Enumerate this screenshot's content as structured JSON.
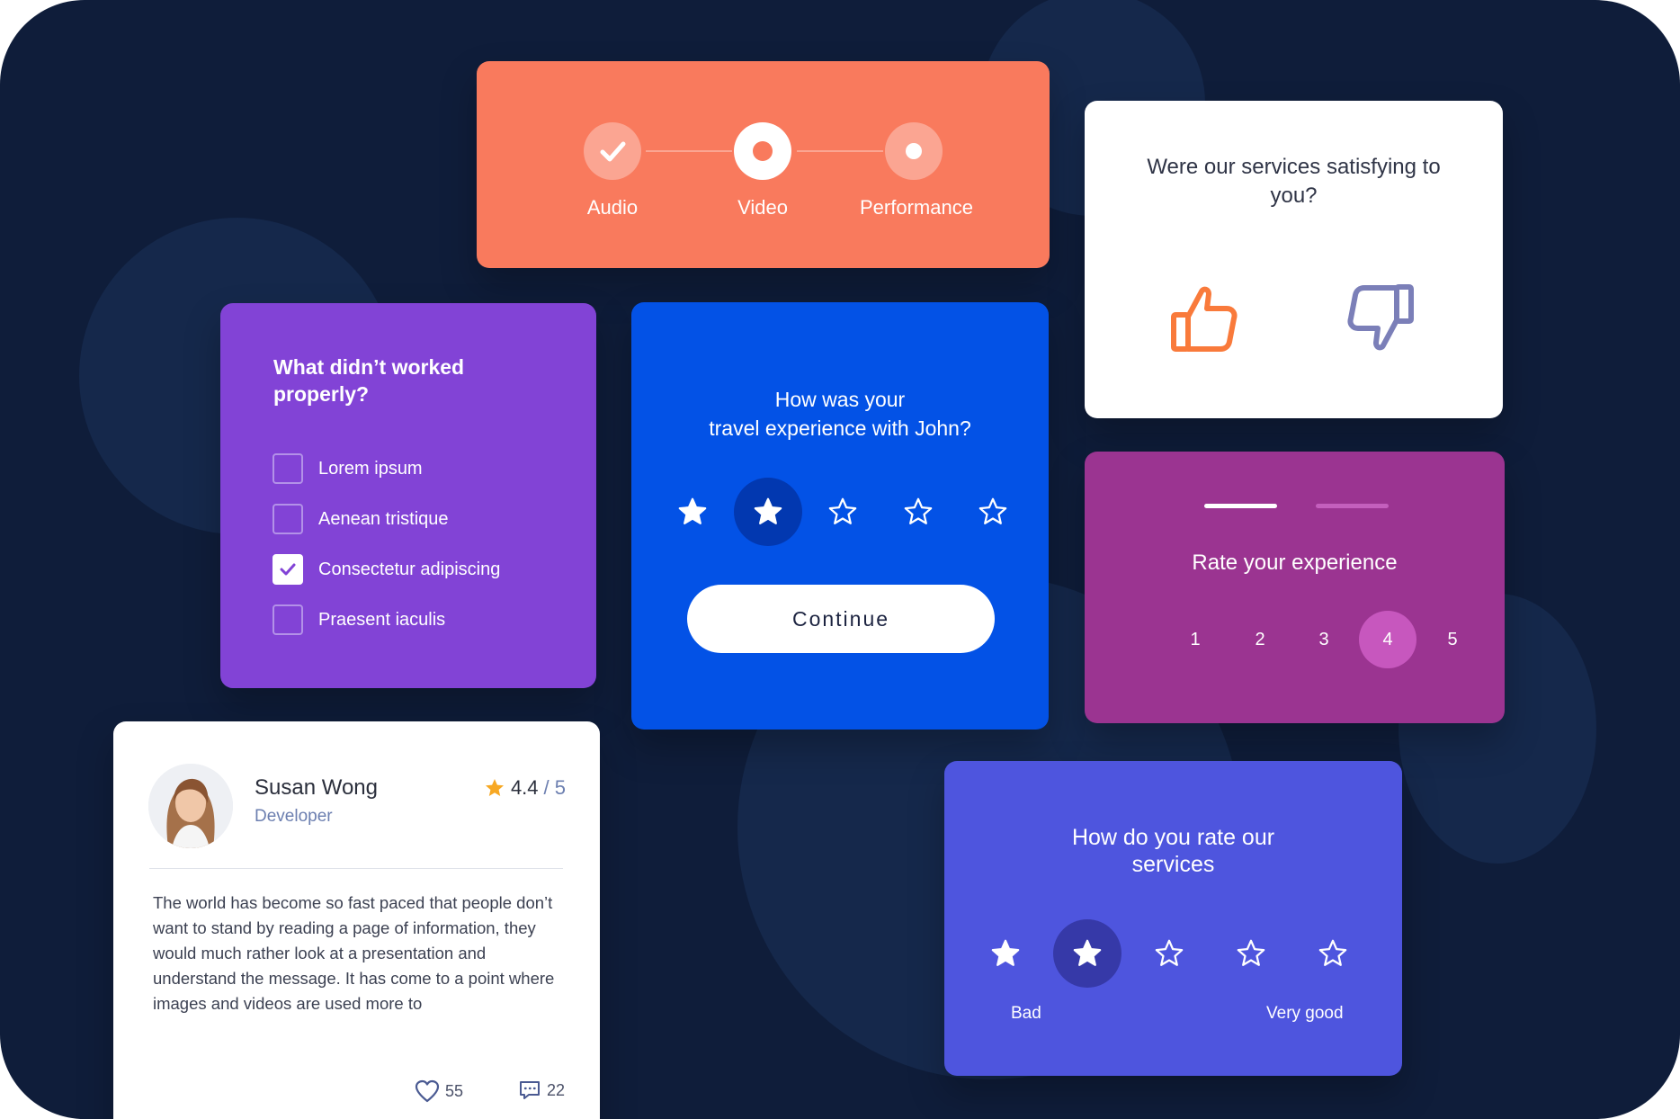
{
  "colors": {
    "background": "#0f1d3a",
    "stepper_card": "#f97a5d",
    "checklist_card": "#8243d6",
    "travel_card": "#0352e6",
    "rate_card": "#9b3491",
    "services_card": "#4e55de",
    "thumb_up": "#f97a3b",
    "thumb_down": "#7b7fb8"
  },
  "stepper": {
    "steps": [
      {
        "label": "Audio",
        "state": "completed",
        "icon": "check-icon"
      },
      {
        "label": "Video",
        "state": "current",
        "icon": "dot-icon"
      },
      {
        "label": "Performance",
        "state": "upcoming",
        "icon": "dot-icon"
      }
    ]
  },
  "satisfaction": {
    "question": "Were our services satisfying to you?",
    "options": [
      {
        "icon": "thumbs-up-icon"
      },
      {
        "icon": "thumbs-down-icon"
      }
    ]
  },
  "checklist": {
    "title": "What didn’t worked properly?",
    "items": [
      {
        "label": "Lorem ipsum",
        "checked": false
      },
      {
        "label": "Aenean tristique",
        "checked": false
      },
      {
        "label": "Consectetur adipiscing",
        "checked": true
      },
      {
        "label": "Praesent iaculis",
        "checked": false
      }
    ]
  },
  "travel": {
    "question_line1": "How was your",
    "question_line2": "travel experience with John?",
    "rating": 2,
    "max_rating": 5,
    "button_label": "Continue"
  },
  "rate_experience": {
    "title": "Rate your experience",
    "page_index": 1,
    "page_count": 2,
    "options": [
      "1",
      "2",
      "3",
      "4",
      "5"
    ],
    "selected": "4"
  },
  "review": {
    "name": "Susan Wong",
    "role": "Developer",
    "rating": "4.4",
    "rating_out_of": "/ 5",
    "text": "The world has become so fast paced that people don’t want to stand by reading a page of information, they would much rather look at a presentation and understand the message. It has come to a point where images and videos are used more to",
    "likes": "55",
    "comments": "22"
  },
  "services": {
    "question_line1": "How do you rate our",
    "question_line2": "services",
    "rating": 2,
    "max_rating": 5,
    "low_label": "Bad",
    "high_label": "Very good"
  }
}
